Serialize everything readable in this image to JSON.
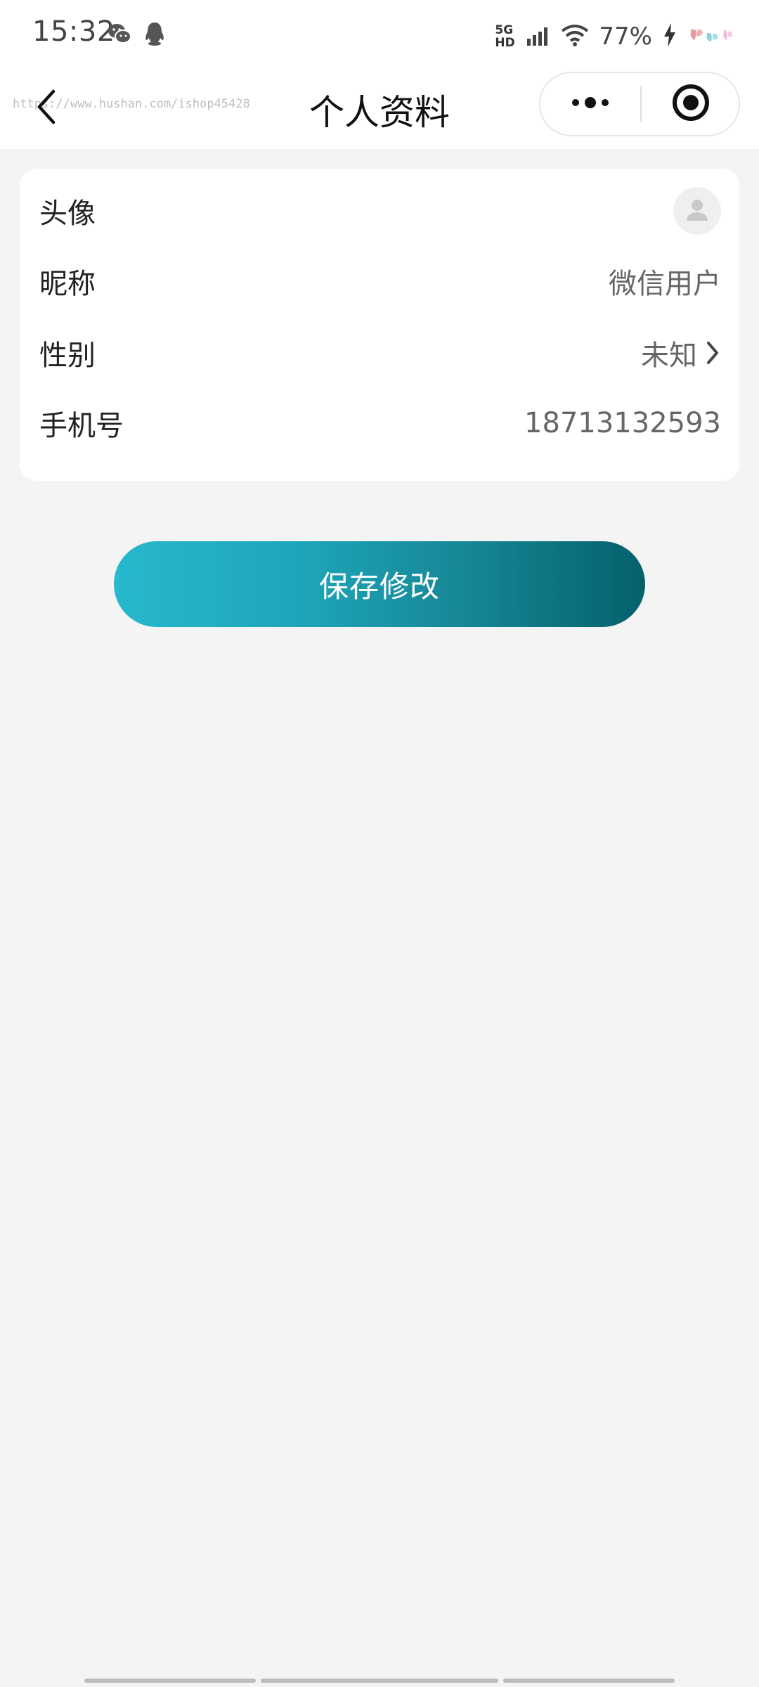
{
  "status_bar": {
    "time": "15:32",
    "network_top": "5G HD",
    "battery": "77%",
    "icons": [
      "wechat-icon",
      "qq-icon",
      "signal-icon",
      "wifi-icon",
      "charging-icon"
    ]
  },
  "nav": {
    "title": "个人资料",
    "watermark": "https://www.hushan.com/ishop45428",
    "back_icon": "chevron-left-icon",
    "more_icon": "more-dots-icon",
    "close_icon": "target-close-icon"
  },
  "profile": {
    "rows": [
      {
        "label": "头像",
        "value_icon": "avatar-placeholder-icon"
      },
      {
        "label": "昵称",
        "value": "微信用户"
      },
      {
        "label": "性别",
        "value": "未知",
        "value_icon": "chevron-right-icon"
      },
      {
        "label": "手机号",
        "value": "18713132593"
      }
    ]
  },
  "actions": {
    "save_label": "保存修改"
  },
  "colors": {
    "accent_start": "#27b8ce",
    "accent_end": "#05606c",
    "page_bg": "#f4f4f4"
  }
}
